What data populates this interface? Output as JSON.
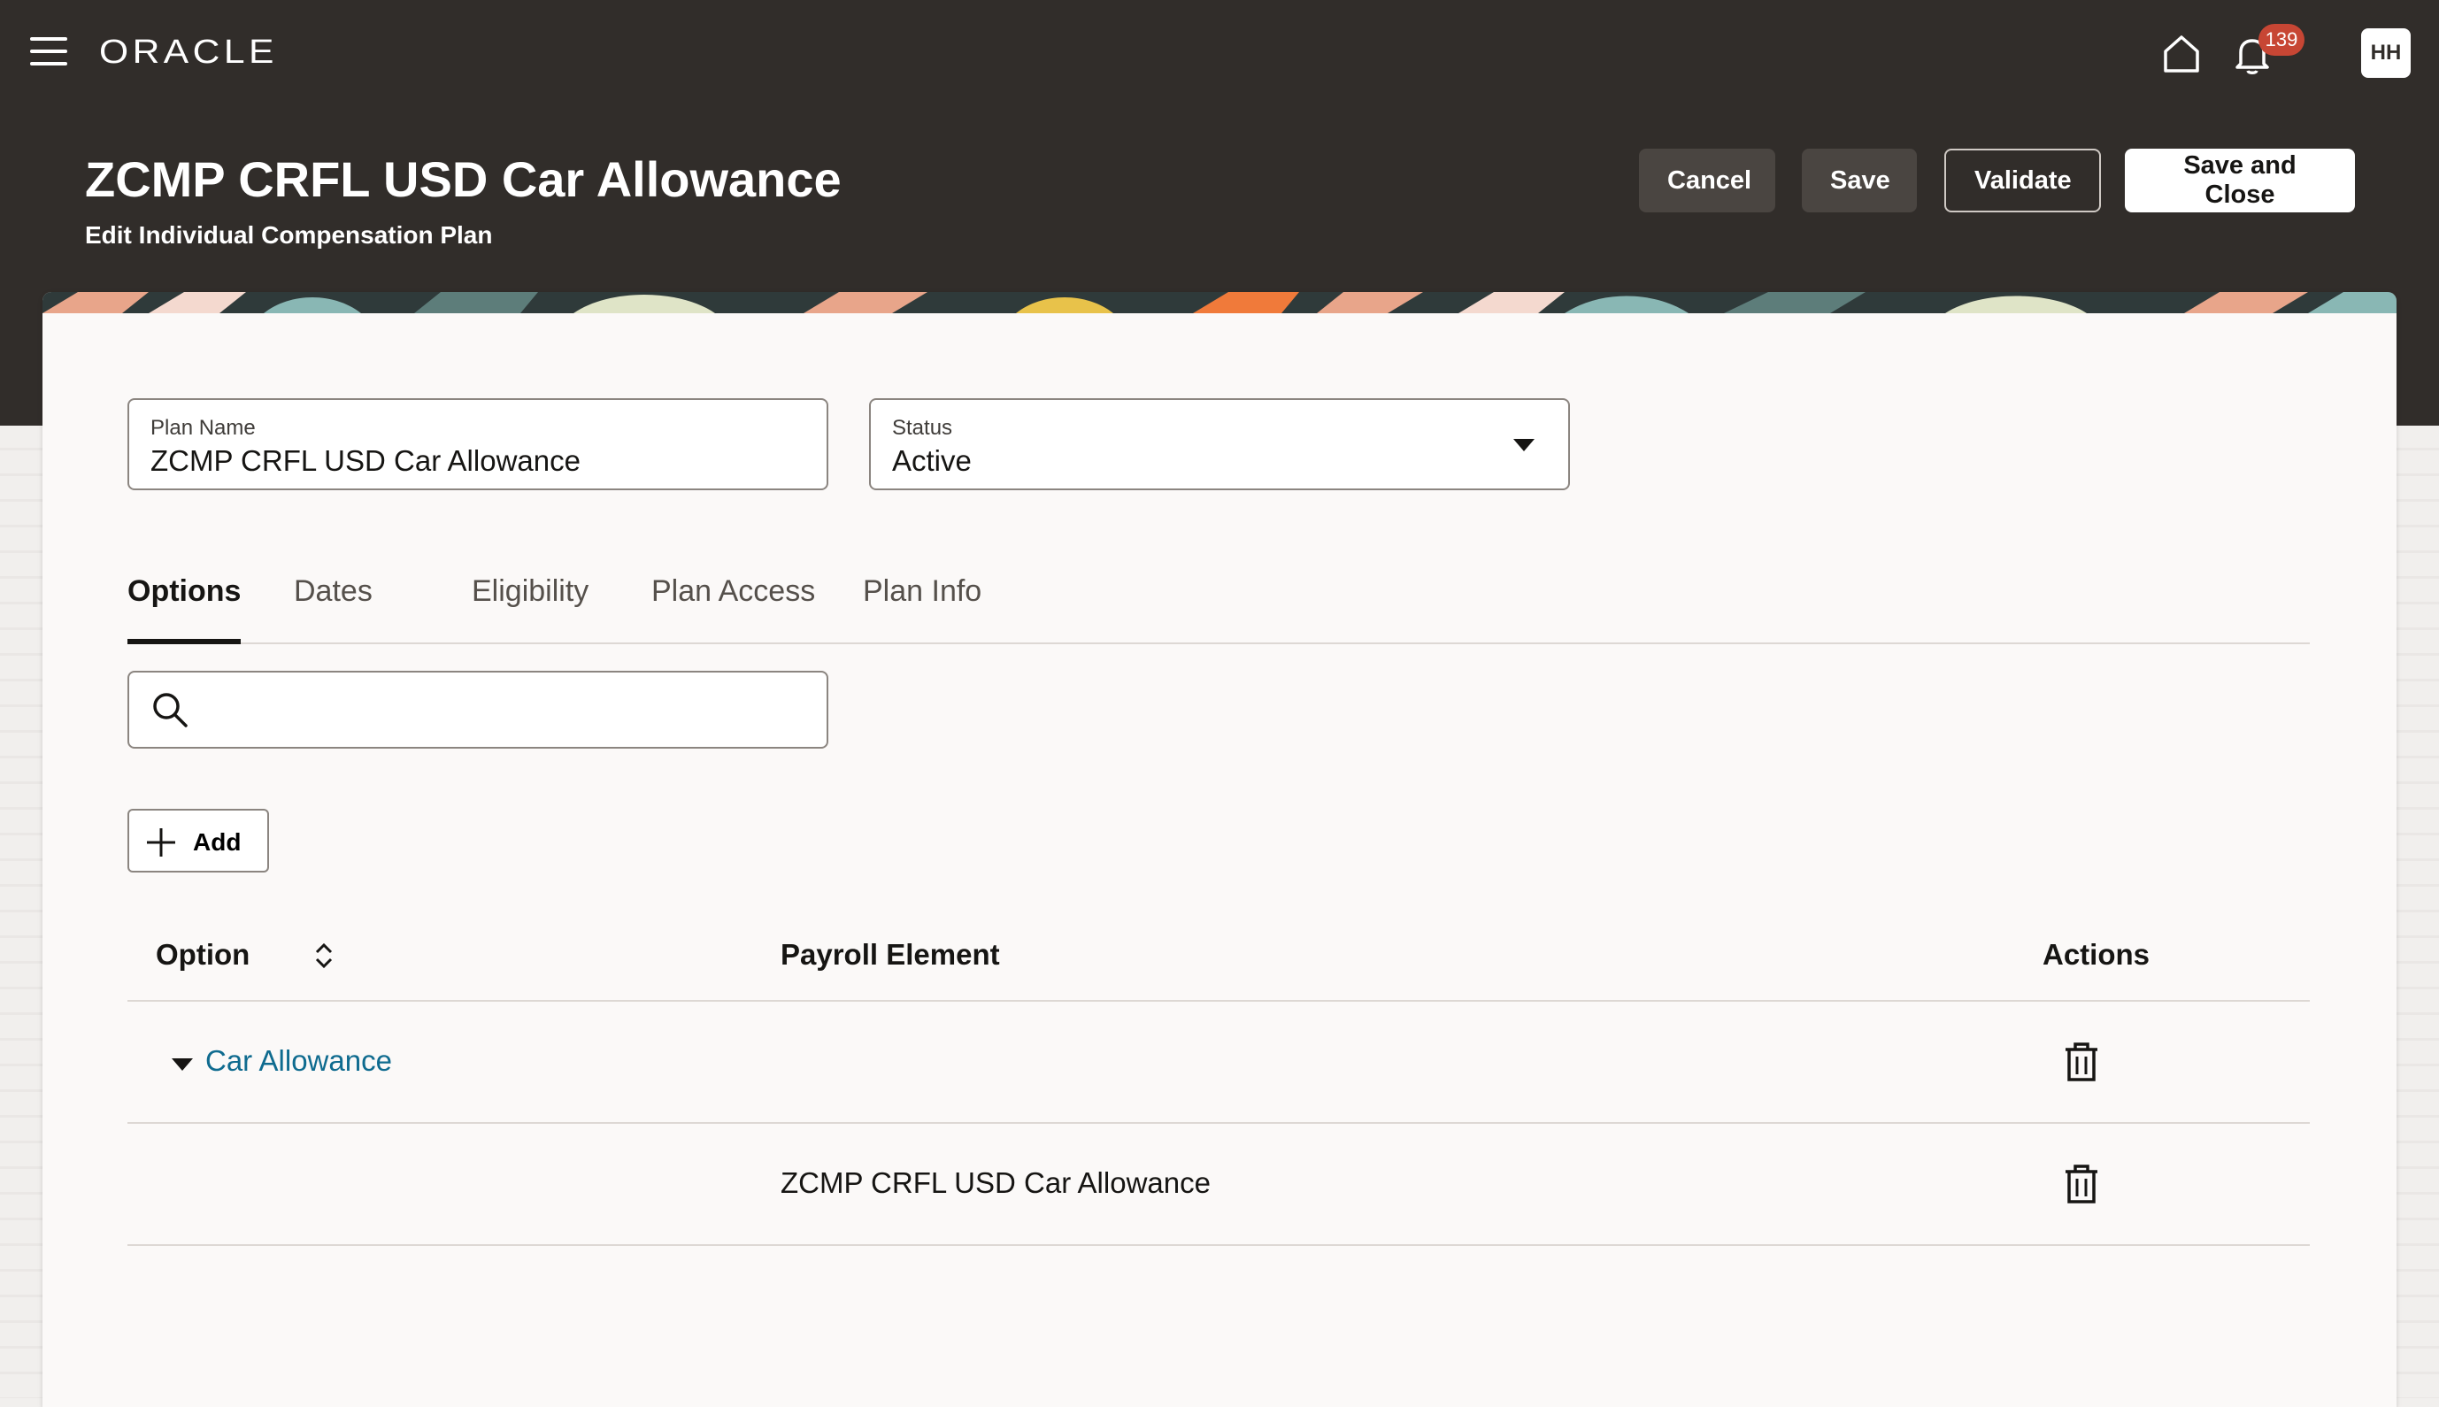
{
  "app": {
    "brand": "ORACLE",
    "notification_count": "139",
    "user_initials": "HH"
  },
  "page": {
    "title": "ZCMP CRFL USD Car Allowance",
    "subtitle": "Edit Individual Compensation Plan"
  },
  "actions": {
    "cancel": "Cancel",
    "save": "Save",
    "validate": "Validate",
    "save_and_close": "Save and Close"
  },
  "form": {
    "plan_name_label": "Plan Name",
    "plan_name_value": "ZCMP CRFL USD Car Allowance",
    "status_label": "Status",
    "status_value": "Active"
  },
  "tabs": [
    {
      "label": "Options",
      "active": true
    },
    {
      "label": "Dates",
      "active": false
    },
    {
      "label": "Eligibility",
      "active": false
    },
    {
      "label": "Plan Access",
      "active": false
    },
    {
      "label": "Plan Info",
      "active": false
    }
  ],
  "search": {
    "placeholder": "",
    "value": ""
  },
  "add_label": "Add",
  "table": {
    "columns": [
      "Option",
      "Payroll Element",
      "Actions"
    ],
    "rows": [
      {
        "option": "Car Allowance",
        "payroll_element": "",
        "expanded": true
      },
      {
        "option": "",
        "payroll_element": "ZCMP CRFL USD Car Allowance"
      }
    ]
  },
  "icons": [
    "hamburger-menu-icon",
    "home-icon",
    "bell-icon",
    "search-icon",
    "plus-icon",
    "sort-icon",
    "trash-icon",
    "chevron-down-icon"
  ],
  "colors": {
    "header_bg": "#312d2a",
    "badge": "#c74634",
    "link": "#0f6b8f",
    "card_bg": "#fbf9f8"
  }
}
